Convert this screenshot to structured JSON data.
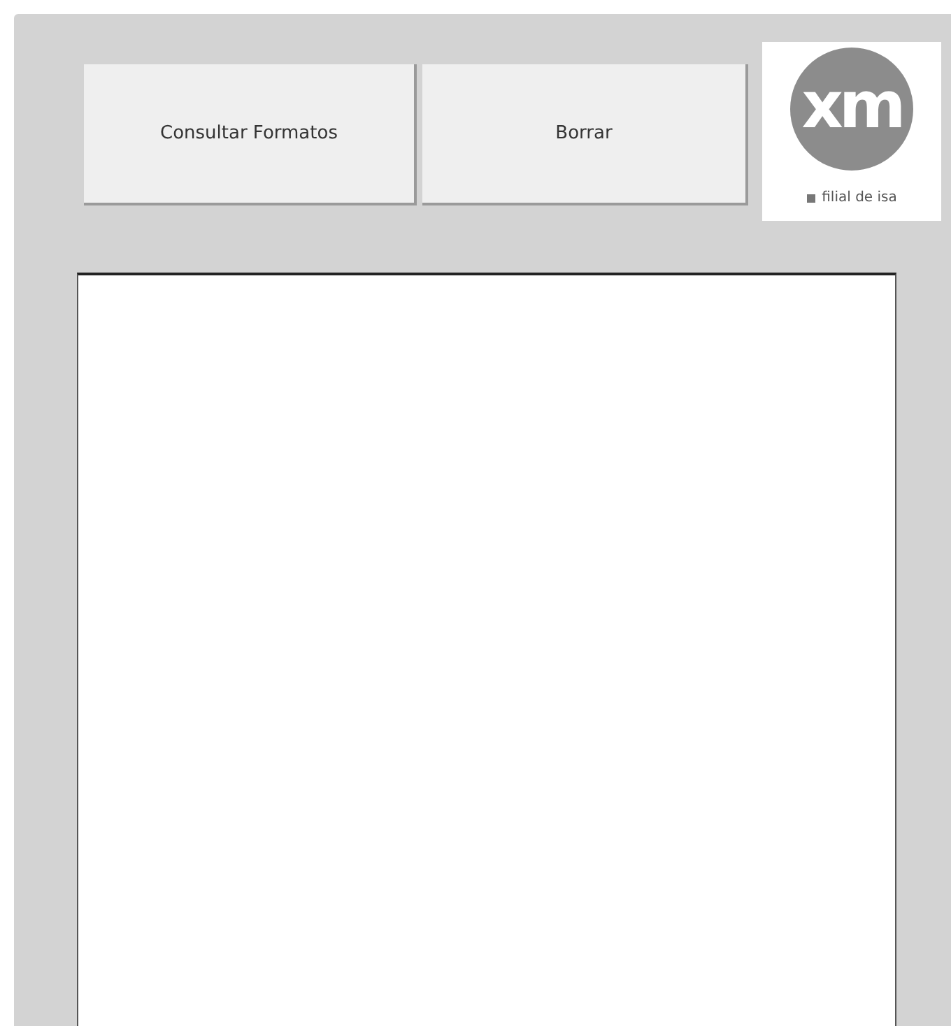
{
  "buttons": [
    {
      "label": "Consultar Formatos"
    },
    {
      "label": "Borrar"
    }
  ],
  "logo": {
    "mark": "xm",
    "caption": "filial de isa"
  }
}
